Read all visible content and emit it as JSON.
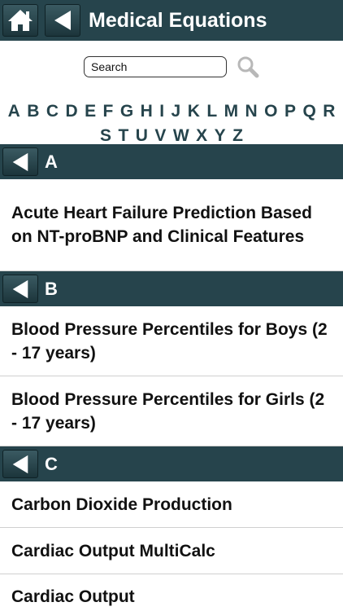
{
  "header": {
    "title": "Medical Equations",
    "home_icon": "home-icon",
    "back_icon": "back-arrow-icon"
  },
  "search": {
    "placeholder": "Search",
    "icon": "magnifier-icon"
  },
  "alphabet": [
    "A",
    "B",
    "C",
    "D",
    "E",
    "F",
    "G",
    "H",
    "I",
    "J",
    "K",
    "L",
    "M",
    "N",
    "O",
    "P",
    "Q",
    "R",
    "S",
    "T",
    "U",
    "V",
    "W",
    "X",
    "Y",
    "Z"
  ],
  "sections": [
    {
      "letter": "A",
      "items": [
        "Acute Heart Failure Prediction Based on NT-proBNP and Clinical Features"
      ]
    },
    {
      "letter": "B",
      "items": [
        "Blood Pressure Percentiles for Boys (2 - 17 years)",
        "Blood Pressure Percentiles for Girls (2 - 17 years)"
      ]
    },
    {
      "letter": "C",
      "items": [
        "Carbon Dioxide Production",
        "Cardiac Output MultiCalc",
        "Cardiac Output"
      ]
    }
  ],
  "colors": {
    "bar": "#26444c",
    "accent_text": "#26444c"
  }
}
